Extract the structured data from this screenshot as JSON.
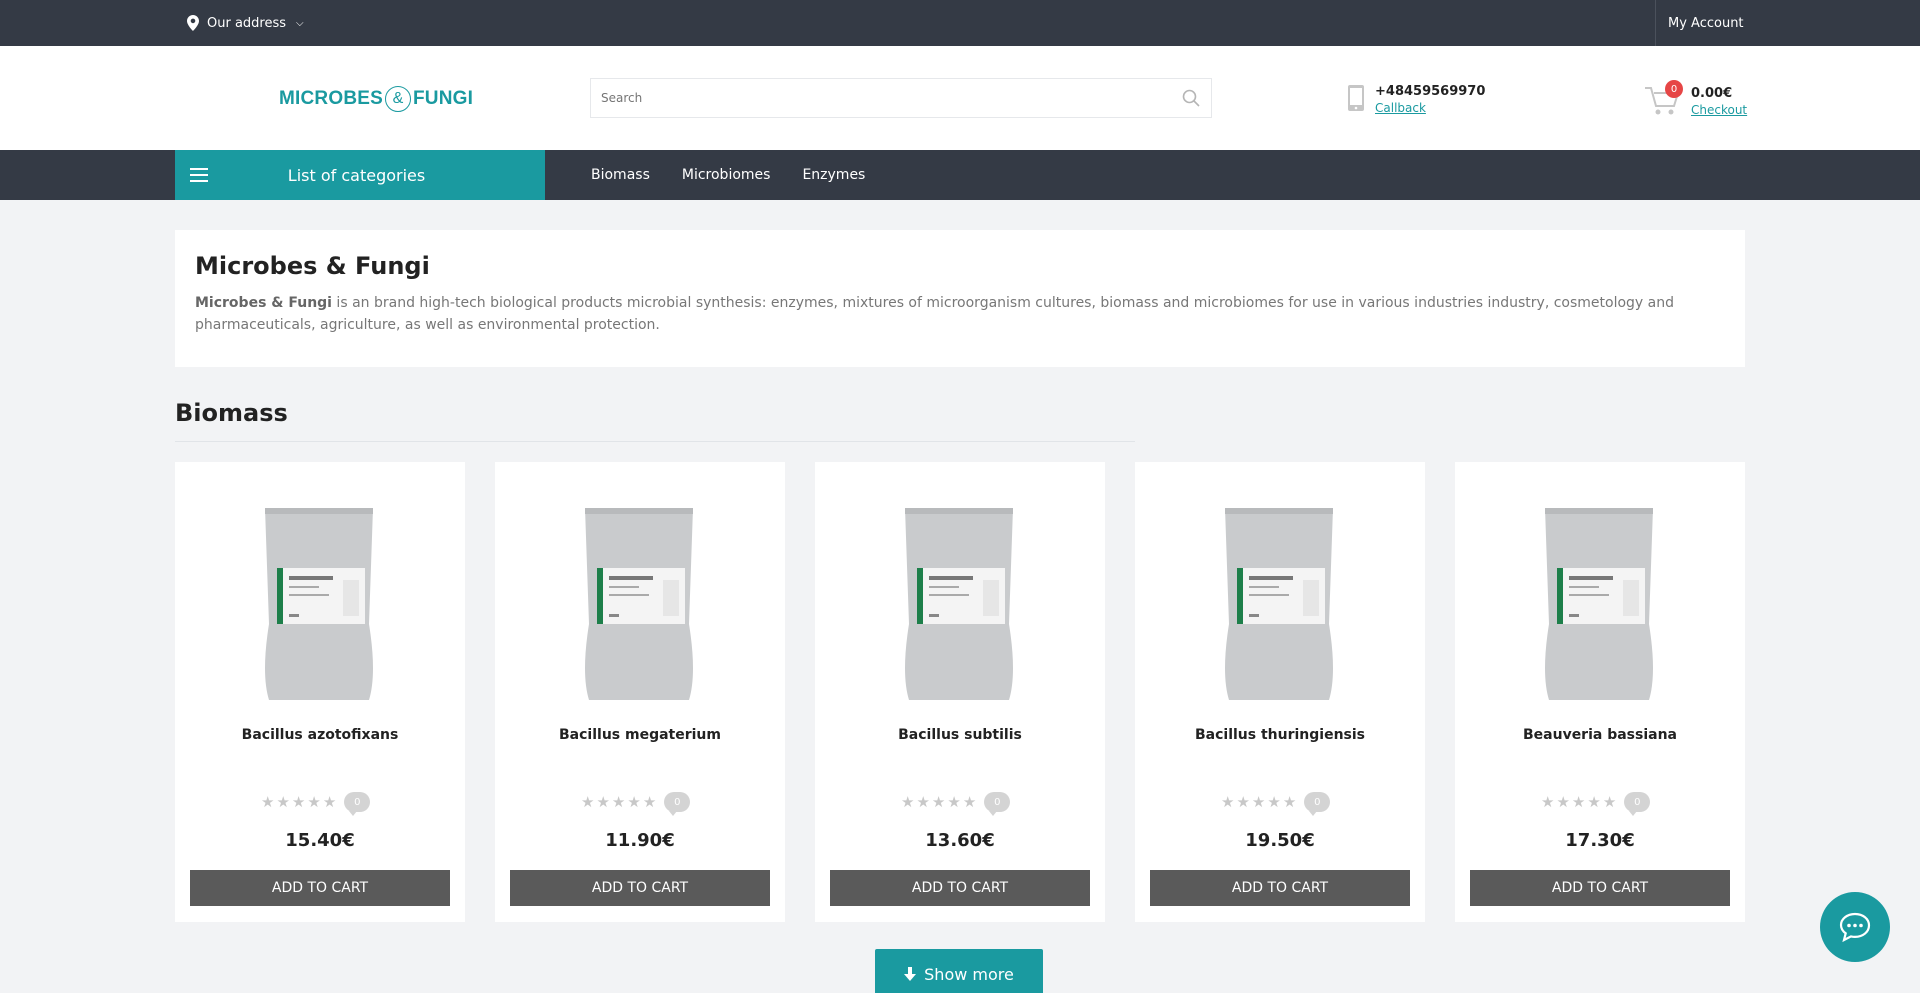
{
  "topbar": {
    "address_label": "Our address",
    "account_label": "My Account"
  },
  "header": {
    "logo_left": "MICROBES",
    "logo_amp": "&",
    "logo_right": "FUNGI",
    "search_placeholder": "Search",
    "phone_number": "+48459569970",
    "callback_label": "Callback",
    "cart_count": "0",
    "cart_total": "0.00€",
    "checkout_label": "Checkout"
  },
  "nav": {
    "categories_label": "List of categories",
    "links": [
      "Biomass",
      "Microbiomes",
      "Enzymes"
    ]
  },
  "about": {
    "title": "Microbes & Fungi",
    "brand": "Microbes & Fungi",
    "text": " is an brand high-tech biological products microbial synthesis: enzymes, mixtures of microorganism cultures, biomass and microbiomes for use in various industries industry, cosmetology and pharmaceuticals, agriculture, as well as environmental protection."
  },
  "biomass": {
    "title": "Biomass",
    "add_label": "ADD TO CART",
    "products": [
      {
        "name": "Bacillus azotofixans",
        "price": "15.40€",
        "reviews": "0",
        "rating": 0
      },
      {
        "name": "Bacillus megaterium",
        "price": "11.90€",
        "reviews": "0",
        "rating": 0
      },
      {
        "name": "Bacillus subtilis",
        "price": "13.60€",
        "reviews": "0",
        "rating": 0
      },
      {
        "name": "Bacillus thuringiensis",
        "price": "19.50€",
        "reviews": "0",
        "rating": 0
      },
      {
        "name": "Beauveria bassiana",
        "price": "17.30€",
        "reviews": "0",
        "rating": 0
      }
    ],
    "show_more_label": "Show more"
  },
  "colors": {
    "accent": "#1a9aa0",
    "dark": "#343a45",
    "button": "#5a5a5a",
    "badge": "#e64646"
  },
  "icons": [
    "map-pin-icon",
    "chevron-down-icon",
    "search-icon",
    "phone-icon",
    "cart-icon",
    "menu-icon",
    "star-icon",
    "comment-icon",
    "arrow-down-icon",
    "chat-icon"
  ]
}
